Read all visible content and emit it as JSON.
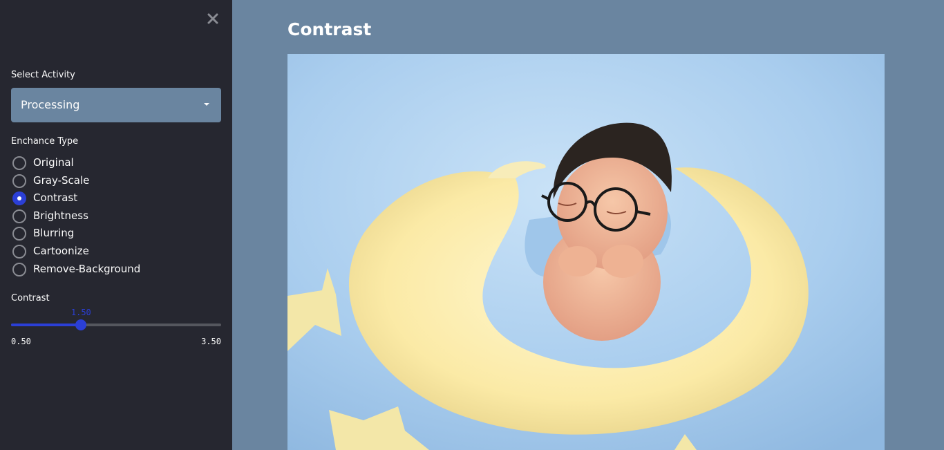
{
  "sidebar": {
    "select_activity_label": "Select Activity",
    "selected_activity": "Processing",
    "enhance_type_label": "Enchance Type",
    "options": [
      "Original",
      "Gray-Scale",
      "Contrast",
      "Brightness",
      "Blurring",
      "Cartoonize",
      "Remove-Background"
    ],
    "selected_option": "Contrast",
    "slider": {
      "label": "Contrast",
      "value": "1.50",
      "min": "0.50",
      "max": "3.50",
      "value_num": 1.5,
      "min_num": 0.5,
      "max_num": 3.5
    }
  },
  "main": {
    "title": "Contrast"
  },
  "colors": {
    "sidebar_bg": "#262730",
    "main_bg": "#6a85a0",
    "accent": "#2b3fd6"
  },
  "icons": {
    "close": "close-icon",
    "caret": "caret-down-icon"
  }
}
